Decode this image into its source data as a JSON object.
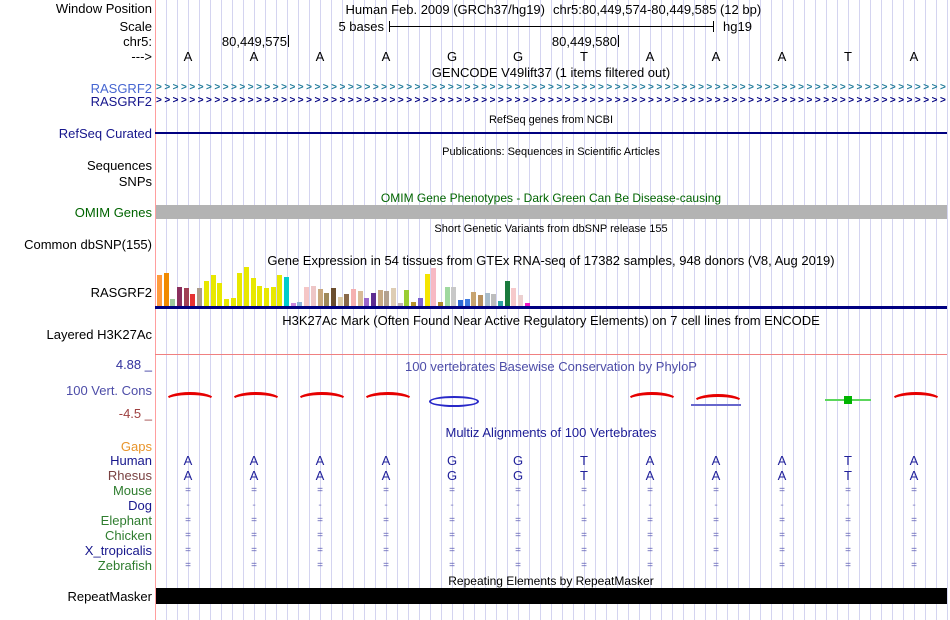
{
  "header": {
    "window_position_label": "Window Position",
    "assembly": "Human Feb. 2009 (GRCh37/hg19)",
    "position": "chr5:80,449,574-80,449,585 (12 bp)",
    "scale_label": "Scale",
    "scale_value": "5 bases",
    "assembly_short": "hg19",
    "chrom_label": "chr5:",
    "coordinate_left": "80,449,575",
    "coordinate_right": "80,449,580",
    "strand_label": "--->"
  },
  "sequence": {
    "bases": [
      "A",
      "A",
      "A",
      "A",
      "G",
      "G",
      "T",
      "A",
      "A",
      "A",
      "T",
      "A"
    ]
  },
  "tracks": {
    "gencode": {
      "title": "GENCODE V49lift37 (1 items filtered out)",
      "arrow_char": ">",
      "arrow_count": 110,
      "items": [
        {
          "label": "RASGRF2",
          "label_color": "#4666d1",
          "arrow_color": "#1f7a99"
        },
        {
          "label": "RASGRF2",
          "label_color": "#16168c",
          "arrow_color": "#000080"
        }
      ]
    },
    "refseq": {
      "title": "RefSeq genes from NCBI",
      "label": "RefSeq Curated",
      "label_color": "#16168c",
      "line_color": "#000080"
    },
    "publications": {
      "title": "Publications: Sequences in Scientific Articles",
      "label_sequences": "Sequences",
      "label_snps": "SNPs"
    },
    "omim": {
      "title": "OMIM Gene Phenotypes - Dark Green Can Be Disease-causing",
      "label": "OMIM Genes",
      "text_color": "#006400",
      "bar_color": "#b3b3b3"
    },
    "dbsnp": {
      "title": "Short Genetic Variants from dbSNP release 155",
      "label": "Common dbSNP(155)"
    },
    "gtex": {
      "title": "Gene Expression in 54 tissues from GTEx RNA-seq of 17382 samples, 948 donors (V8, Aug 2019)",
      "label": "RASGRF2",
      "baseline_color": "#000080",
      "bars": [
        {
          "c": "#ff9a3d",
          "h": 0.74
        },
        {
          "c": "#f08a00",
          "h": 0.78
        },
        {
          "c": "#9dc89d",
          "h": 0.16
        },
        {
          "c": "#8a2f5e",
          "h": 0.46
        },
        {
          "c": "#a04055",
          "h": 0.42
        },
        {
          "c": "#e63232",
          "h": 0.28
        },
        {
          "c": "#ab9b8a",
          "h": 0.42
        },
        {
          "c": "#e8e800",
          "h": 0.6
        },
        {
          "c": "#e8e800",
          "h": 0.74
        },
        {
          "c": "#e8e800",
          "h": 0.54
        },
        {
          "c": "#e8e800",
          "h": 0.17
        },
        {
          "c": "#e8e800",
          "h": 0.2
        },
        {
          "c": "#e8e800",
          "h": 0.78
        },
        {
          "c": "#e8e800",
          "h": 0.92
        },
        {
          "c": "#e8e800",
          "h": 0.66
        },
        {
          "c": "#e8e800",
          "h": 0.48
        },
        {
          "c": "#e8e800",
          "h": 0.42
        },
        {
          "c": "#e8e800",
          "h": 0.46
        },
        {
          "c": "#e8e800",
          "h": 0.74
        },
        {
          "c": "#00cccc",
          "h": 0.68
        },
        {
          "c": "#cc88dd",
          "h": 0.07
        },
        {
          "c": "#8fb4d9",
          "h": 0.1
        },
        {
          "c": "#f5c6c6",
          "h": 0.46
        },
        {
          "c": "#eec6c6",
          "h": 0.48
        },
        {
          "c": "#c9a87c",
          "h": 0.4
        },
        {
          "c": "#a08a5a",
          "h": 0.3
        },
        {
          "c": "#6b4e2e",
          "h": 0.42
        },
        {
          "c": "#dcc9a5",
          "h": 0.22
        },
        {
          "c": "#8a6a4a",
          "h": 0.28
        },
        {
          "c": "#f5b0b0",
          "h": 0.4
        },
        {
          "c": "#d9bb97",
          "h": 0.36
        },
        {
          "c": "#9966cc",
          "h": 0.2
        },
        {
          "c": "#5e2d91",
          "h": 0.3
        },
        {
          "c": "#c7a983",
          "h": 0.38
        },
        {
          "c": "#b3a18f",
          "h": 0.35
        },
        {
          "c": "#decdb4",
          "h": 0.42
        },
        {
          "c": "#c0b4b4",
          "h": 0.08
        },
        {
          "c": "#9acd32",
          "h": 0.38
        },
        {
          "c": "#b8942e",
          "h": 0.1
        },
        {
          "c": "#7a5fd0",
          "h": 0.2
        },
        {
          "c": "#f5e500",
          "h": 0.76
        },
        {
          "c": "#f7b9c4",
          "h": 0.9
        },
        {
          "c": "#ad8b2d",
          "h": 0.1
        },
        {
          "c": "#9fd89f",
          "h": 0.46
        },
        {
          "c": "#c8c8c8",
          "h": 0.46
        },
        {
          "c": "#2e6bd6",
          "h": 0.15
        },
        {
          "c": "#3f7ae0",
          "h": 0.17
        },
        {
          "c": "#c8a470",
          "h": 0.34
        },
        {
          "c": "#b8905e",
          "h": 0.25
        },
        {
          "c": "#a8bccb",
          "h": 0.3
        },
        {
          "c": "#bdbdbd",
          "h": 0.28
        },
        {
          "c": "#2fa3a3",
          "h": 0.12
        },
        {
          "c": "#1a7a3c",
          "h": 0.6
        },
        {
          "c": "#f6c9cb",
          "h": 0.42
        },
        {
          "c": "#ecd0d0",
          "h": 0.26
        },
        {
          "c": "#f014c8",
          "h": 0.07
        }
      ]
    },
    "h3k27ac": {
      "title": "H3K27Ac Mark (Often Found Near Active Regulatory Elements) on 7 cell lines from ENCODE",
      "label": "Layered H3K27Ac",
      "line_color": "#f08080"
    },
    "phylop": {
      "title": "100 vertebrates Basewise Conservation by PhyloP",
      "label": "100 Vert. Cons",
      "max_value": "4.88 _",
      "min_value": "-4.5 _",
      "title_color": "#4d4da8",
      "max_color": "#32329e",
      "min_color": "#9e4040",
      "glyphs": [
        "red-arc",
        "red-arc",
        "red-arc",
        "red-arc",
        "blue-lens",
        "none",
        "none",
        "red-arc",
        "red-arc-blue",
        "none",
        "green-line-square",
        "red-arc"
      ]
    },
    "multiz": {
      "title": "Multiz Alignments of 100 Vertebrates",
      "title_color": "#1c1c96",
      "gaps_label": "Gaps",
      "gaps_color": "#e8942a",
      "letter_color": "#22229b",
      "eq_color": "#5b5bb4",
      "dash_color": "#7979c0",
      "species": [
        {
          "name": "Human",
          "color": "#16168c",
          "symbols": [
            "A",
            "A",
            "A",
            "A",
            "G",
            "G",
            "T",
            "A",
            "A",
            "A",
            "T",
            "A"
          ]
        },
        {
          "name": "Rhesus",
          "color": "#7a4242",
          "symbols": [
            "A",
            "A",
            "A",
            "A",
            "G",
            "G",
            "T",
            "A",
            "A",
            "A",
            "T",
            "A"
          ]
        },
        {
          "name": "Mouse",
          "color": "#2f7d2f",
          "symbols": [
            "=",
            "=",
            "=",
            "=",
            "=",
            "=",
            "=",
            "=",
            "=",
            "=",
            "=",
            "="
          ]
        },
        {
          "name": "Dog",
          "color": "#16168c",
          "symbols": [
            "-",
            "-",
            "-",
            "-",
            "-",
            "-",
            "-",
            "-",
            "-",
            "-",
            "-",
            "-"
          ]
        },
        {
          "name": "Elephant",
          "color": "#2f7d2f",
          "symbols": [
            "=",
            "=",
            "=",
            "=",
            "=",
            "=",
            "=",
            "=",
            "=",
            "=",
            "=",
            "="
          ]
        },
        {
          "name": "Chicken",
          "color": "#2f7d2f",
          "symbols": [
            "=",
            "=",
            "=",
            "=",
            "=",
            "=",
            "=",
            "=",
            "=",
            "=",
            "=",
            "="
          ]
        },
        {
          "name": "X_tropicalis",
          "color": "#16168c",
          "symbols": [
            "=",
            "=",
            "=",
            "=",
            "=",
            "=",
            "=",
            "=",
            "=",
            "=",
            "=",
            "="
          ]
        },
        {
          "name": "Zebrafish",
          "color": "#2f7d2f",
          "symbols": [
            "=",
            "=",
            "=",
            "=",
            "=",
            "=",
            "=",
            "=",
            "=",
            "=",
            "=",
            "="
          ]
        }
      ]
    },
    "repeatmasker": {
      "title": "Repeating Elements by RepeatMasker",
      "label": "RepeatMasker",
      "bar_color": "#000000"
    }
  }
}
